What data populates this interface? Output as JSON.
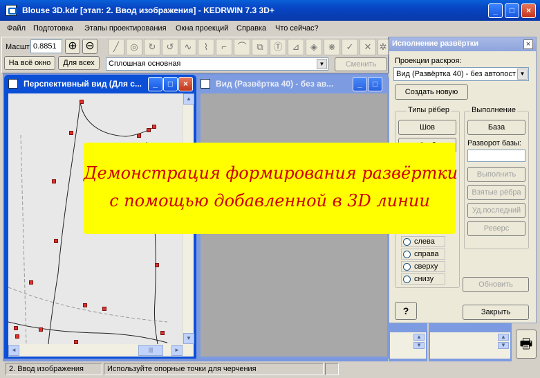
{
  "window": {
    "title": "Blouse 3D.kdr [этап: 2. Ввод изображения] - KEDRWIN 7.3 3D+",
    "min": "_",
    "max": "□",
    "close": "×"
  },
  "menu": [
    "Файл",
    "Подготовка",
    "Этапы проектирования",
    "Окна проекций",
    "Справка",
    "Что сейчас?"
  ],
  "toolbar": {
    "scale_label": "Масшт",
    "scale_value": "0.8851",
    "zoom_in": "⊕",
    "zoom_out": "⊖",
    "fit_window": "На всё окно",
    "fit_all": "Для всех",
    "line_style": "Сплошная основная",
    "change": "Сменить"
  },
  "perspective": {
    "title": "Перспективный вид (Для с...",
    "min": "_",
    "max": "□",
    "close": "×"
  },
  "view40": {
    "title": "Вид (Развёртка 40) - без ав...",
    "min": "_",
    "max": "□",
    "close": "×"
  },
  "panel": {
    "title": "Исполнение развёртки",
    "close": "×",
    "proj_label": "Проекции раскроя:",
    "proj_value": "Вид (Развёртка 40) - без автопост",
    "create_new": "Создать новую",
    "edge_types": "Типы рёбер",
    "seam": "Шов",
    "fold": "Сгиб",
    "execution": "Выполнение",
    "base": "База",
    "base_turn_label": "Разворот базы:",
    "base_turn_value": "",
    "execute": "Выполнить",
    "taken_edges": "Взятые рёбра",
    "delete_last": "Уд.последний",
    "reverse": "Реверс",
    "directions": [
      "слева",
      "справа",
      "сверху",
      "снизу"
    ],
    "update": "Обновить",
    "help": "?",
    "close_btn": "Закрыть"
  },
  "banner": {
    "line1": "Демонстрация формирования развёртки",
    "line2": "с помощью добавленной в 3D линии",
    "bg_color": "#ffff00",
    "text_color": "#cc0000"
  },
  "status": {
    "stage": "2. Ввод изображения",
    "hint": "Используйте опорные точки для черчения"
  },
  "icons": {
    "scroll_up": "▲",
    "scroll_down": "▼",
    "scroll_left": "◄",
    "scroll_right": "►",
    "combo": "▼",
    "grip": "|||",
    "printer": "🖶"
  }
}
